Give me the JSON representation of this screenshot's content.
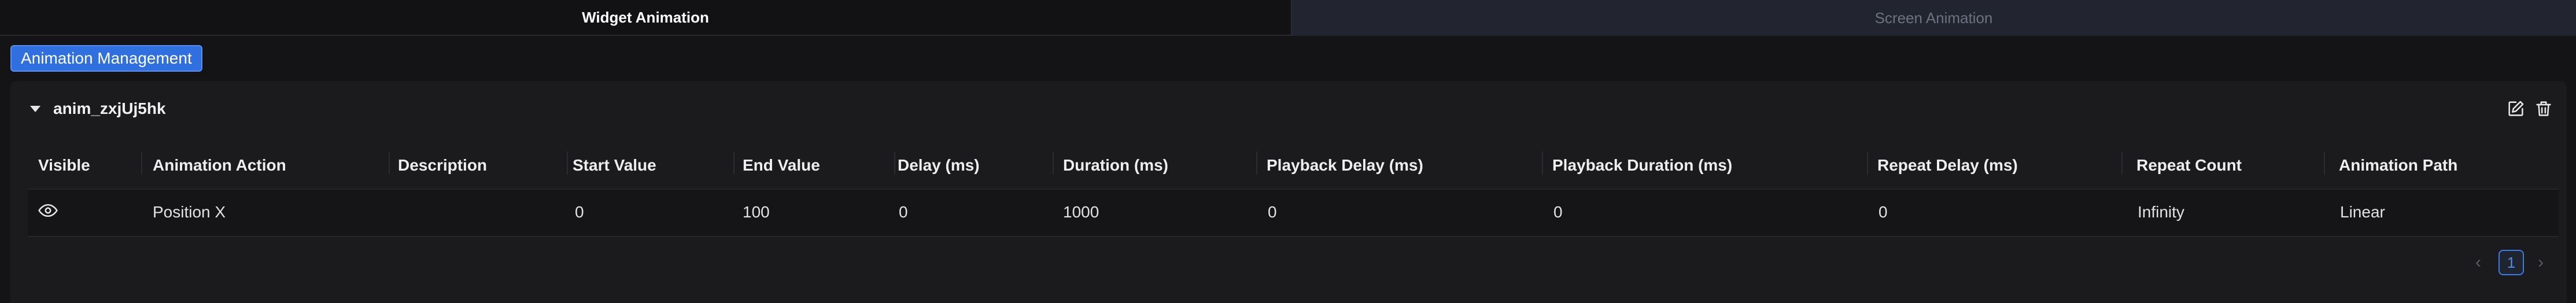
{
  "tabs": [
    {
      "label": "Widget Animation"
    },
    {
      "label": "Screen Animation"
    }
  ],
  "management_button": "Animation Management",
  "animation": {
    "name": "anim_zxjUj5hk"
  },
  "table": {
    "headers": [
      "Visible",
      "Animation Action",
      "Description",
      "Start Value",
      "End Value",
      "Delay (ms)",
      "Duration (ms)",
      "Playback Delay (ms)",
      "Playback Duration (ms)",
      "Repeat Delay (ms)",
      "Repeat Count",
      "Animation Path"
    ],
    "rows": [
      {
        "visible_icon": "eye-icon",
        "action": "Position X",
        "description": "",
        "start": "0",
        "end": "100",
        "delay": "0",
        "duration": "1000",
        "playback_delay": "0",
        "playback_duration": "0",
        "repeat_delay": "0",
        "repeat_count": "Infinity",
        "path": "Linear"
      }
    ]
  },
  "pagination": {
    "prev": "‹",
    "current": "1",
    "next": "›"
  },
  "colors": {
    "accent": "#2f6fe0",
    "background": "#141416",
    "panel": "#1b1b1d"
  }
}
